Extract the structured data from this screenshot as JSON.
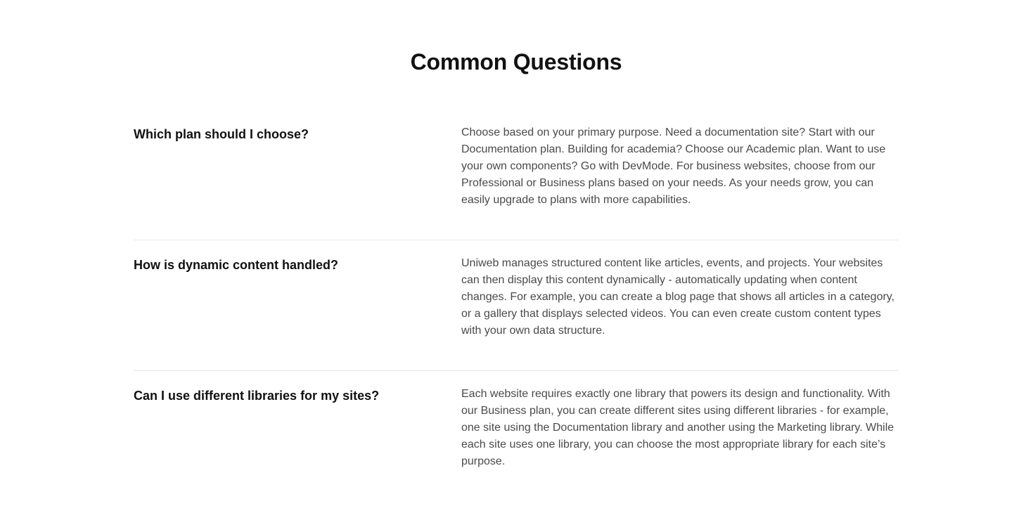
{
  "faq": {
    "title": "Common Questions",
    "items": [
      {
        "question": "Which plan should I choose?",
        "answer": "Choose based on your primary purpose. Need a documentation site? Start with our Documentation plan. Building for academia? Choose our Academic plan. Want to use your own components? Go with DevMode. For business websites, choose from our Professional or Business plans based on your needs. As your needs grow, you can easily upgrade to plans with more capabilities."
      },
      {
        "question": "How is dynamic content handled?",
        "answer": "Uniweb manages structured content like articles, events, and projects. Your websites can then display this content dynamically - automatically updating when content changes. For example, you can create a blog page that shows all articles in a category, or a gallery that displays selected videos. You can even create custom content types with your own data structure."
      },
      {
        "question": "Can I use different libraries for my sites?",
        "answer": "Each website requires exactly one library that powers its design and functionality. With our Business plan, you can create different sites using different libraries - for example, one site using the Documentation library and another using the Marketing library. While each site uses one library, you can choose the most appropriate library for each site’s purpose."
      }
    ]
  }
}
